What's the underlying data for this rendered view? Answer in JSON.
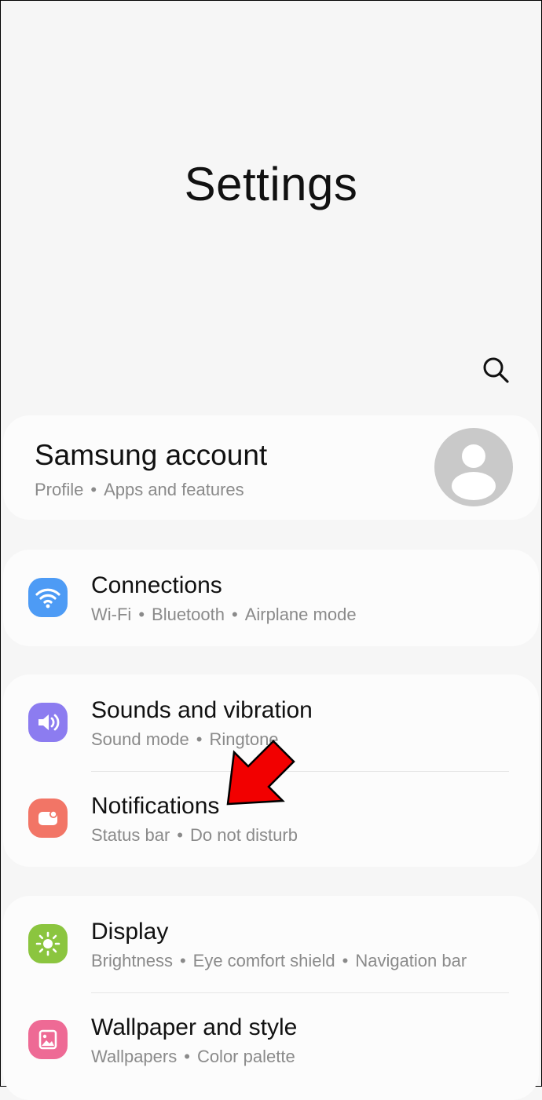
{
  "header": {
    "title": "Settings"
  },
  "account": {
    "title": "Samsung account",
    "sub": [
      "Profile",
      "Apps and features"
    ]
  },
  "items": [
    {
      "label": "Connections",
      "sub": [
        "Wi-Fi",
        "Bluetooth",
        "Airplane mode"
      ],
      "icon": "wifi-icon",
      "color": "#4d9bf5"
    },
    {
      "label": "Sounds and vibration",
      "sub": [
        "Sound mode",
        "Ringtone"
      ],
      "icon": "volume-icon",
      "color": "#8c7cf0"
    },
    {
      "label": "Notifications",
      "sub": [
        "Status bar",
        "Do not disturb"
      ],
      "icon": "notification-icon",
      "color": "#f27566"
    },
    {
      "label": "Display",
      "sub": [
        "Brightness",
        "Eye comfort shield",
        "Navigation bar"
      ],
      "icon": "sun-icon",
      "color": "#8bc53f"
    },
    {
      "label": "Wallpaper and style",
      "sub": [
        "Wallpapers",
        "Color palette"
      ],
      "icon": "wallpaper-icon",
      "color": "#ee6a95"
    }
  ],
  "annotation": {
    "icon": "red-arrow-icon",
    "color": "#f20000"
  }
}
